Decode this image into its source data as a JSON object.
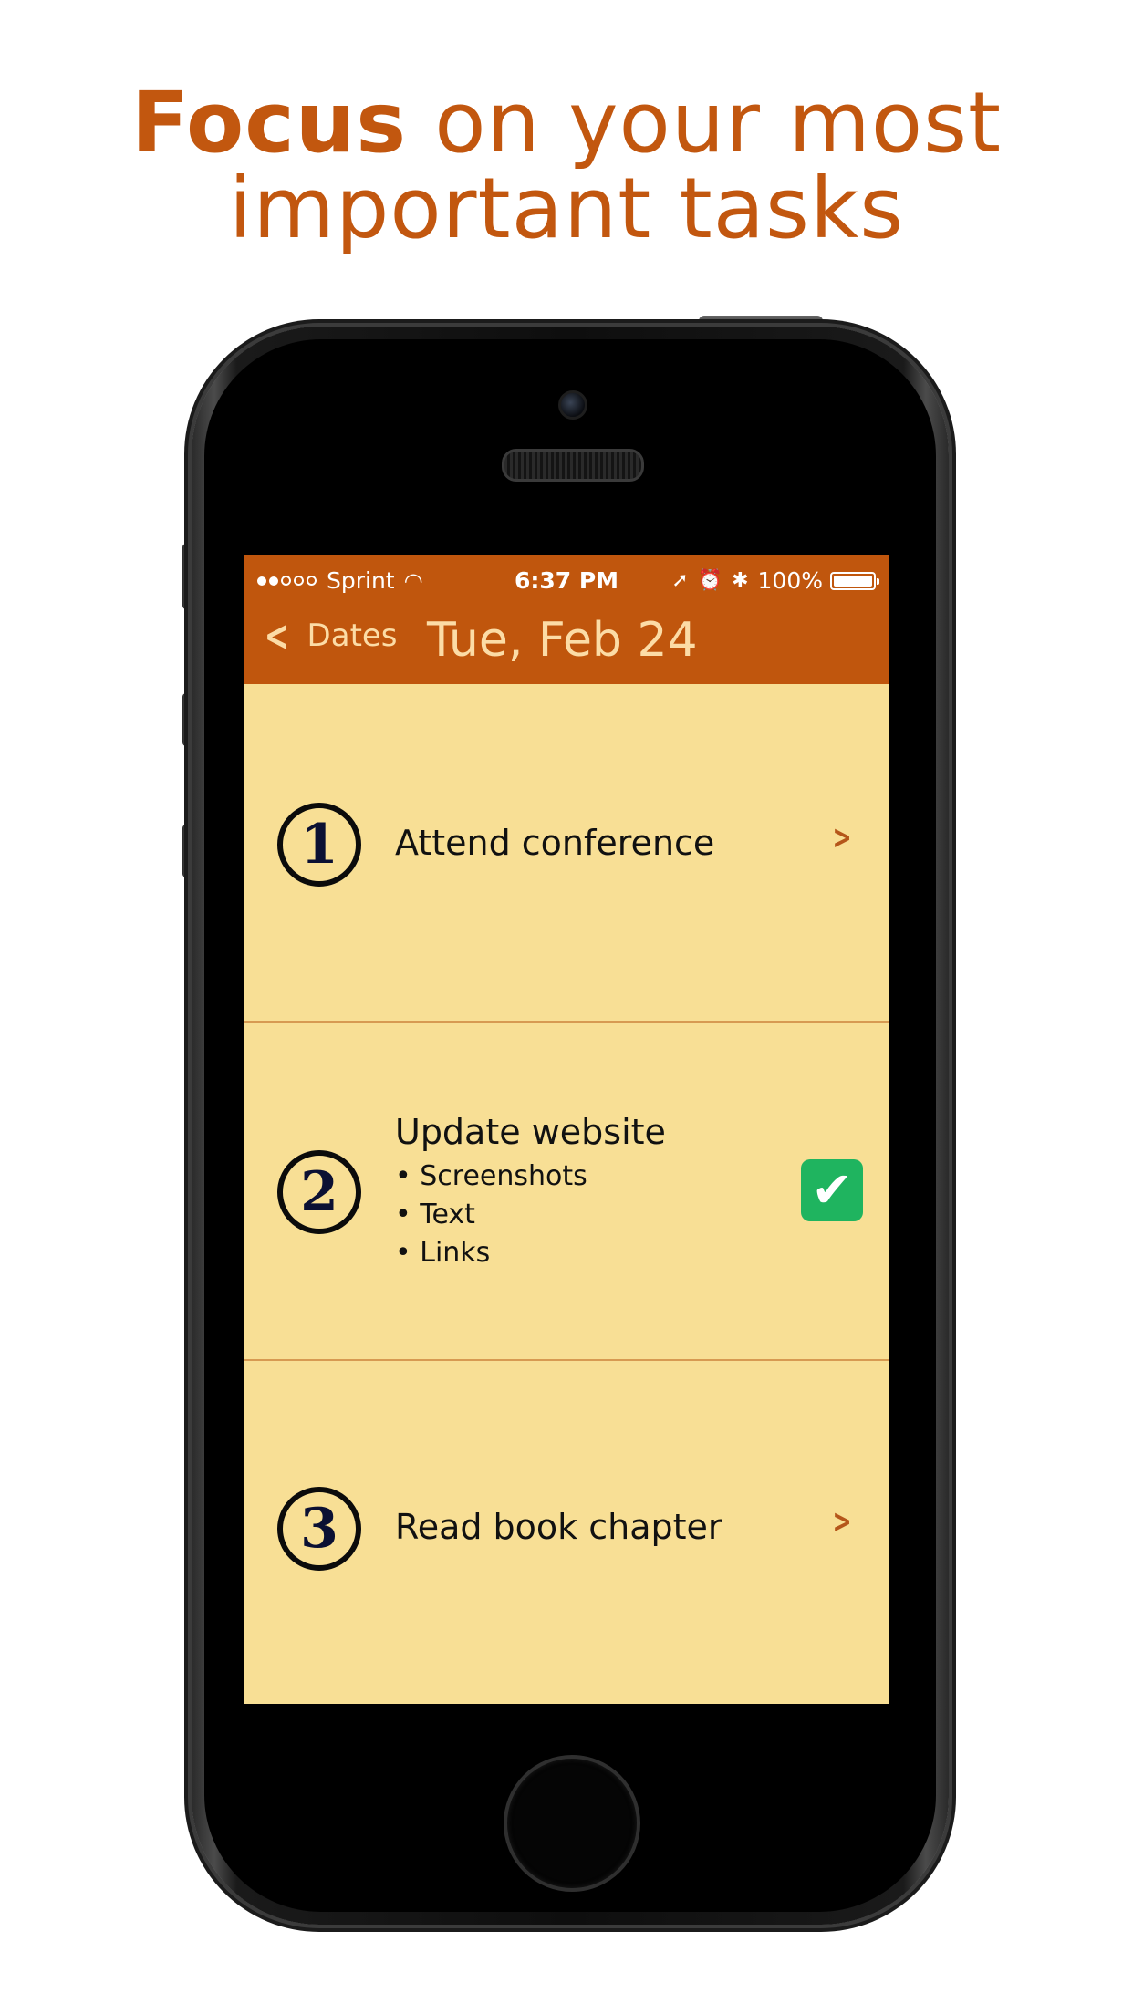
{
  "headline": {
    "bold": "Focus",
    "rest": "on your most",
    "line2": "important tasks"
  },
  "status_bar": {
    "carrier": "Sprint",
    "time": "6:37 PM",
    "battery": "100%",
    "battery_level": 1.0,
    "signal_bars_filled": 2,
    "signal_bars_total": 5
  },
  "navbar": {
    "back_label": "Dates",
    "title": "Tue, Feb 24"
  },
  "tasks": [
    {
      "number": "1",
      "title": "Attend conference",
      "subitems": [],
      "completed": false
    },
    {
      "number": "2",
      "title": "Update website",
      "subitems": [
        "Screenshots",
        "Text",
        "Links"
      ],
      "completed": true
    },
    {
      "number": "3",
      "title": "Read book chapter",
      "subitems": [],
      "completed": false
    }
  ],
  "colors": {
    "accent": "#c2570f",
    "navbar": "#c0560d",
    "screen_bg": "#f8df95",
    "checkbox": "#1fb45f"
  }
}
